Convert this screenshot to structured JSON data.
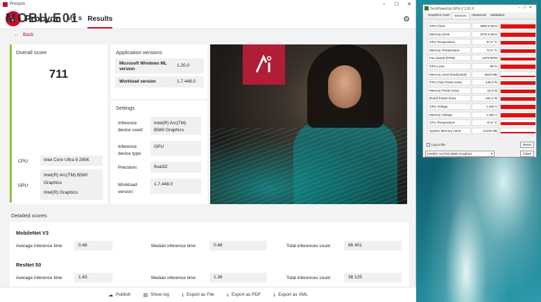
{
  "window": {
    "title": "Procyon"
  },
  "header": {
    "app_name": "Procyon",
    "tab_partial": "My s",
    "tab_results": "Results",
    "watermark": "MOBILE01"
  },
  "nav": {
    "back_label": "Back"
  },
  "overall": {
    "title": "Overall score",
    "score": "711"
  },
  "system": {
    "cpu_label": "CPU:",
    "cpu_value": "Intel Core Ultra 9 285K",
    "gpu_label": "GPU:",
    "gpu_value_1": "Intel(R) Arc(TM) B580 Graphics",
    "gpu_value_2": "Intel(R) Graphics"
  },
  "app_versions": {
    "title": "Application versions",
    "windows_ml_label": "Microsoft Windows ML version",
    "windows_ml_value": "1.20.0",
    "workload_label": "Workload version",
    "workload_value": "1.7.448.0"
  },
  "settings": {
    "title": "Settings",
    "device_used_label": "Inference device used:",
    "device_used_value": "Intel(R) Arc(TM) B580 Graphics",
    "device_type_label": "Inference device type:",
    "device_type_value": "GPU",
    "precision_label": "Precision:",
    "precision_value": "float32",
    "workload_label": "Workload version:",
    "workload_value": "1.7.448.0"
  },
  "detailed": {
    "title": "Detailed scores",
    "avg_label": "Average inference time",
    "median_label": "Median inference time",
    "total_label": "Total inferences count",
    "benchmarks": [
      {
        "name": "MobileNet V3",
        "avg": "0.48",
        "median": "0.46",
        "total": "86 401"
      },
      {
        "name": "ResNet 50",
        "avg": "1.43",
        "median": "1.36",
        "total": "36 125"
      }
    ]
  },
  "footer": {
    "publish": "Publish",
    "show_log": "Show log",
    "export_file": "Export as File",
    "export_pdf": "Export as PDF",
    "export_xml": "Export as XML"
  },
  "gpuz": {
    "title": "TechPowerUp GPU-Z 2.61.0",
    "tabs": [
      "Graphics Card",
      "Sensors",
      "Advanced",
      "Validation"
    ],
    "sensors": [
      {
        "name": "GPU Clock",
        "value": "2850.0 MHz",
        "level": 0.9
      },
      {
        "name": "Memory Clock",
        "value": "2375.0 MHz",
        "level": 0.85
      },
      {
        "name": "GPU Temperature",
        "value": "67.0 °C",
        "level": 0.7
      },
      {
        "name": "Memory Temperature",
        "value": "72.0 °C",
        "level": 0.7
      },
      {
        "name": "Fan Speed (RPM)",
        "value": "1379 RPM",
        "level": 0.6
      },
      {
        "name": "GPU Load",
        "value": "99 %",
        "level": 0.8
      },
      {
        "name": "Memory Used (Dedicated)",
        "value": "2843 MB",
        "level": 0.25
      },
      {
        "name": "GPU Chip Power Draw",
        "value": "136.9 W",
        "level": 0.75
      },
      {
        "name": "Memory Power Draw",
        "value": "18.5 W",
        "level": 0.7
      },
      {
        "name": "Board Power Draw",
        "value": "181.0 W",
        "level": 0.75
      },
      {
        "name": "GPU Voltage",
        "value": "1.020 V",
        "level": 0.8
      },
      {
        "name": "Memory Voltage",
        "value": "1.352 V",
        "level": 0.85
      },
      {
        "name": "CPU Temperature",
        "value": "70.0 °C",
        "level": 0.6
      },
      {
        "name": "System Memory Used",
        "value": "11446 MB",
        "level": 0.3
      }
    ],
    "log_label": "Log to file",
    "reset_label": "Reset",
    "gpu_select": "Intel(R) Arc(TM) B580 Graphics",
    "close_label": "Close"
  }
}
